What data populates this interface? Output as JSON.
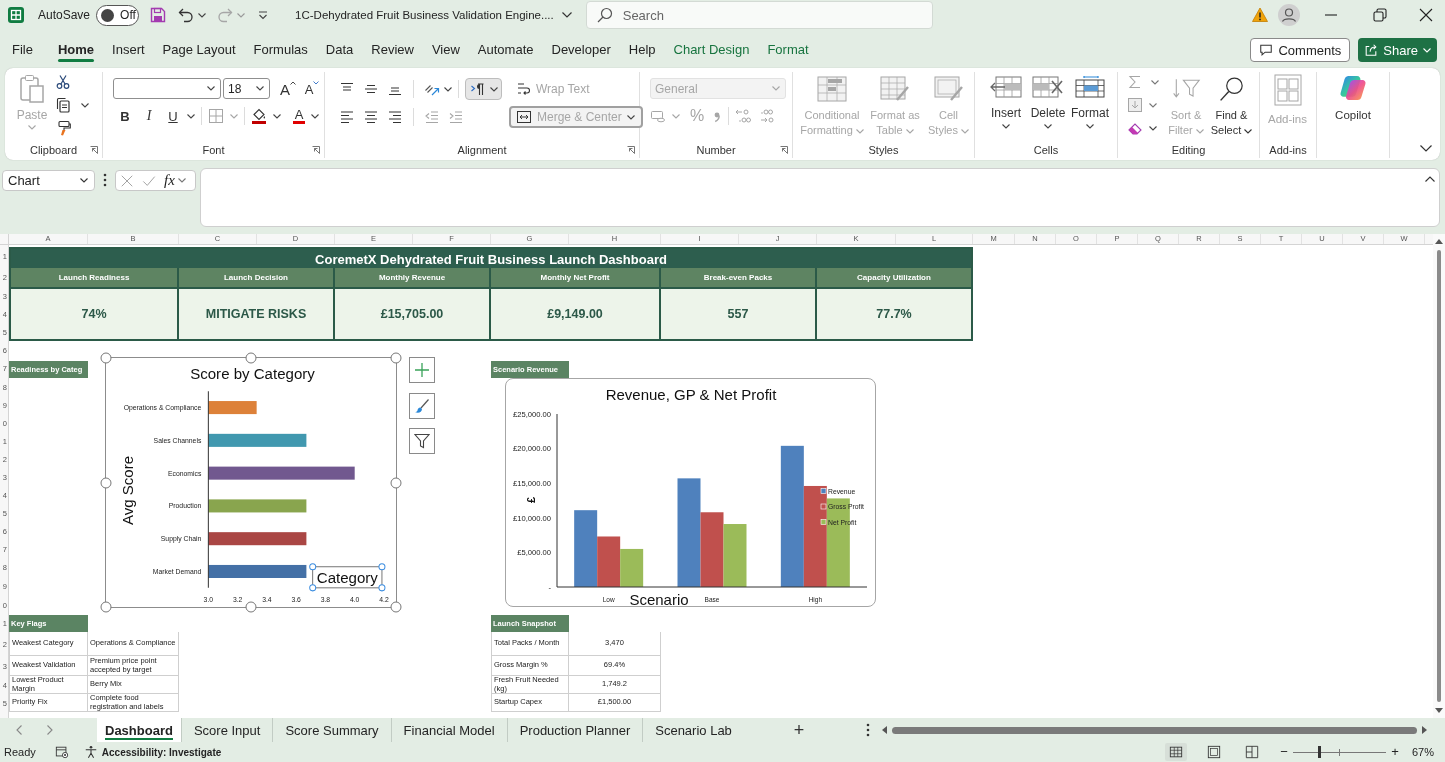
{
  "title_bar": {
    "autosave_label": "AutoSave",
    "autosave_toggle": {
      "on": false,
      "label": "Off"
    },
    "redo": {
      "disabled": true
    },
    "document_title": "1C-Dehydrated Fruit Business Validation Engine....",
    "search": {
      "placeholder": "Search"
    }
  },
  "menu_tabs": [
    {
      "label": "File",
      "selected": false,
      "kind": "standard"
    },
    {
      "label": "Home",
      "selected": true,
      "kind": "standard"
    },
    {
      "label": "Insert",
      "selected": false,
      "kind": "standard"
    },
    {
      "label": "Page Layout",
      "selected": false,
      "kind": "standard"
    },
    {
      "label": "Formulas",
      "selected": false,
      "kind": "standard"
    },
    {
      "label": "Data",
      "selected": false,
      "kind": "standard"
    },
    {
      "label": "Review",
      "selected": false,
      "kind": "standard"
    },
    {
      "label": "View",
      "selected": false,
      "kind": "standard"
    },
    {
      "label": "Automate",
      "selected": false,
      "kind": "standard"
    },
    {
      "label": "Developer",
      "selected": false,
      "kind": "standard"
    },
    {
      "label": "Help",
      "selected": false,
      "kind": "standard"
    },
    {
      "label": "Chart Design",
      "selected": false,
      "kind": "contextual"
    },
    {
      "label": "Format",
      "selected": false,
      "kind": "contextual"
    }
  ],
  "header_buttons": {
    "comments": "Comments",
    "share": "Share"
  },
  "ribbon": {
    "clipboard": {
      "label": "Clipboard",
      "paste": {
        "label": "Paste",
        "disabled": true
      }
    },
    "font": {
      "label": "Font",
      "size": "18",
      "grow": "A",
      "shrink": "A",
      "bold": "B",
      "italic": "I",
      "underline": "U",
      "font_color": "A",
      "borders": {
        "disabled": true
      }
    },
    "alignment": {
      "label": "Alignment",
      "text_direction": {
        "selected": true
      },
      "wrap_text": {
        "label": "Wrap Text",
        "disabled": true
      },
      "indent": {
        "disabled": true
      },
      "merge_center": {
        "label": "Merge & Center",
        "disabled": true
      }
    },
    "number": {
      "label": "Number",
      "format": {
        "value": "General",
        "disabled": true
      },
      "percent": "%",
      "buttons": {
        "disabled": true
      }
    },
    "styles": {
      "label": "Styles",
      "buttons": [
        {
          "label": "Conditional Formatting",
          "disabled": true
        },
        {
          "label": "Format as Table",
          "disabled": true
        },
        {
          "label": "Cell Styles",
          "disabled": true
        }
      ]
    },
    "cells": {
      "label": "Cells",
      "buttons": [
        {
          "label": "Insert",
          "disabled": false
        },
        {
          "label": "Delete",
          "disabled": false
        },
        {
          "label": "Format",
          "disabled": false
        }
      ]
    },
    "editing": {
      "label": "Editing",
      "fill": {
        "disabled": true
      },
      "sort_filter": {
        "label": "Sort & Filter",
        "disabled": true
      },
      "find_select": {
        "label": "Find & Select",
        "disabled": false
      }
    },
    "addins": {
      "label": "Add-ins",
      "button": {
        "label": "Add-ins",
        "disabled": true
      }
    },
    "copilot": {
      "label": "Copilot"
    }
  },
  "formula_bar": {
    "name_box": "Chart",
    "function_label": "fx"
  },
  "sheet": {
    "column_headers": [
      "A",
      "B",
      "C",
      "D",
      "E",
      "F",
      "G",
      "H",
      "I",
      "J",
      "K",
      "L",
      "M",
      "N",
      "O",
      "P",
      "Q",
      "R",
      "S",
      "T",
      "U",
      "V",
      "W"
    ],
    "row_headers": [
      "1",
      "2",
      "3",
      "4",
      "5",
      "6",
      "7",
      "8",
      "9",
      "0",
      "1",
      "2",
      "3",
      "4",
      "5",
      "6",
      "7",
      "8",
      "9",
      "0",
      "1",
      "2",
      "3",
      "4",
      "5"
    ],
    "title": "CoremetX Dehydrated Fruit Business Launch Dashboard",
    "kpis": [
      {
        "label": "Launch Readiness",
        "value": "74%"
      },
      {
        "label": "Launch Decision",
        "value": "MITIGATE RISKS"
      },
      {
        "label": "Monthly Revenue",
        "value": "£15,705.00"
      },
      {
        "label": "Monthly Net Profit",
        "value": "£9,149.00"
      },
      {
        "label": "Break-even Packs",
        "value": "557"
      },
      {
        "label": "Capacity Utilization",
        "value": "77.7%"
      }
    ],
    "readiness_label": "Readiness by Categ",
    "scenario_label": "Scenario Revenue",
    "key_flags": {
      "title": "Key Flags",
      "rows": [
        {
          "label": "Weakest Category",
          "value": "Operations & Compliance"
        },
        {
          "label": "Weakest Validation",
          "value": "Premium price point accepted by target"
        },
        {
          "label": "Lowest Product Margin",
          "value": "Berry Mix"
        },
        {
          "label": "Priority Fix",
          "value": "Complete food registration and labels"
        }
      ]
    },
    "launch_snapshot": {
      "title": "Launch Snapshot",
      "rows": [
        {
          "label": "Total Packs / Month",
          "value": "3,470"
        },
        {
          "label": "Gross Margin %",
          "value": "69.4%"
        },
        {
          "label": "Fresh Fruit Needed (kg)",
          "value": "1,749.2"
        },
        {
          "label": "Startup Capex",
          "value": "£1,500.00"
        }
      ]
    },
    "score_chart": {
      "selected": true,
      "xlabel_selected": true,
      "chart_data": {
        "type": "bar",
        "orientation": "horizontal",
        "title": "Score by Category",
        "xlabel": "Category",
        "ylabel": "Avg Score",
        "categories": [
          "Operations & Compliance",
          "Sales Channels",
          "Economics",
          "Production",
          "Supply Chain",
          "Market Demand"
        ],
        "values": [
          3.33,
          3.67,
          4.0,
          3.67,
          3.67,
          3.67
        ],
        "colors": [
          "#dd8139",
          "#4198af",
          "#71588f",
          "#89a54e",
          "#aa4644",
          "#4470a6"
        ],
        "xlim": [
          3.0,
          4.2
        ],
        "xticks": [
          {
            "value": 3.0,
            "label": "3.0"
          },
          {
            "value": 3.2,
            "label": "3.2"
          },
          {
            "value": 3.4,
            "label": "3.4"
          },
          {
            "value": 3.6,
            "label": "3.6"
          },
          {
            "value": 3.8,
            "label": "3.8"
          },
          {
            "value": 4.0,
            "label": "4.0"
          },
          {
            "value": 4.2,
            "label": "4.2"
          }
        ]
      }
    },
    "revenue_chart": {
      "chart_data": {
        "type": "bar",
        "title": "Revenue, GP & Net Profit",
        "xlabel": "Scenario",
        "ylabel": "£",
        "categories": [
          "Low",
          "Base",
          "High"
        ],
        "series": [
          {
            "name": "Revenue",
            "color": "#4f81bd",
            "values": [
              11100,
              15700,
              20400
            ]
          },
          {
            "name": "Gross Profit",
            "color": "#c0504d",
            "values": [
              7300,
              10800,
              14600
            ]
          },
          {
            "name": "Net Profit",
            "color": "#9bbb59",
            "values": [
              5500,
              9100,
              12800
            ]
          }
        ],
        "legend": "right",
        "ylim": [
          0,
          25000
        ],
        "yticks": [
          {
            "value": 0,
            "label": "-"
          },
          {
            "value": 5000,
            "label": "£5,000.00"
          },
          {
            "value": 10000,
            "label": "£10,000.00"
          },
          {
            "value": 15000,
            "label": "£15,000.00"
          },
          {
            "value": 20000,
            "label": "£20,000.00"
          },
          {
            "value": 25000,
            "label": "£25,000.00"
          }
        ]
      }
    }
  },
  "sheet_tabs": [
    {
      "label": "Dashboard",
      "selected": true
    },
    {
      "label": "Score Input",
      "selected": false
    },
    {
      "label": "Score Summary",
      "selected": false
    },
    {
      "label": "Financial Model",
      "selected": false
    },
    {
      "label": "Production Planner",
      "selected": false
    },
    {
      "label": "Scenario Lab",
      "selected": false
    }
  ],
  "add_sheet": "+",
  "status_bar": {
    "status": "Ready",
    "accessibility": "Accessibility: Investigate",
    "views": [
      {
        "selected": true
      },
      {
        "selected": false
      },
      {
        "selected": false
      }
    ],
    "zoom_out": "−",
    "zoom_slider": {
      "level": 0.29
    },
    "zoom_in": "+",
    "zoom": "67%"
  }
}
